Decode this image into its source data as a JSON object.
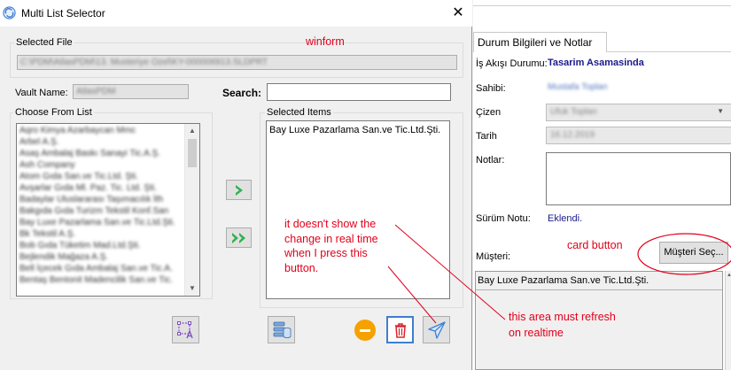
{
  "dialog": {
    "title": "Multi List Selector",
    "close_glyph": "✕",
    "selected_file": {
      "label": "Selected File",
      "value": "C:\\PDM\\AtlasPDM\\13. Musteriye Ozel\\KY-000006913.SLDPRT"
    },
    "vault": {
      "label": "Vault Name:",
      "value": "AtlasPDM"
    },
    "search": {
      "label": "Search:",
      "value": ""
    },
    "choose_list": {
      "label": "Choose From List",
      "items": [
        "Aqro Kimya Azarbaycan Mmc",
        "Arbel A.Ş.",
        "Asaş Ambalaj Baskı Sanayi Tic.A.Ş.",
        "Ash Company",
        "Atom Gıda San.ve Tic.Ltd. Şti.",
        "Avşarlar Gıda Ml. Paz. Tic. Ltd. Şti.",
        "Badaylar Uluslararası Taşımacılık İth",
        "Bakgıda Gıda Turizm Tekstil Konf.San",
        "Bay Luxe Pazarlama San.ve Tic.Ltd.Şti.",
        "Bk Tekstil A.Ş.",
        "Bob Gıda Tüketim Mad.Ltd.Şti.",
        "Bejlendik Mağaza A.Ş.",
        "Bell İçecek Gıda Ambalaj San.ve Tic.A.",
        "Bentaş Bentonit Madencilik San.ve Tic."
      ]
    },
    "selected_items": {
      "label": "Selected Items",
      "items": [
        "Bay Luxe Pazarlama San.ve Tic.Ltd.Şti."
      ]
    },
    "annotations": {
      "winform": "winform",
      "no_realtime": [
        "it doesn't show the",
        "change in real time",
        "when I press this",
        "button."
      ]
    }
  },
  "panel": {
    "tab": "Durum Bilgileri ve Notlar",
    "workflow": {
      "label": "İş Akışı Durumu:",
      "value": "Tasarim Asamasinda"
    },
    "owner": {
      "label": "Sahibi:",
      "value": "Mustafa Toplan"
    },
    "drawer": {
      "label": "Çizen",
      "value": "Ufuk Toplan"
    },
    "date": {
      "label": "Tarih",
      "value": "16.12.2019"
    },
    "notes": {
      "label": "Notlar:",
      "value": ""
    },
    "version_note": {
      "label": "Sürüm Notu:",
      "value": "Eklendi."
    },
    "customer": {
      "label": "Müşteri:",
      "button": "Müşteri Seç...",
      "value": "Bay Luxe Pazarlama San.ve Tic.Ltd.Şti."
    },
    "annotations": {
      "card_button": "card button",
      "refresh": [
        "this area must refresh",
        "on realtime"
      ]
    }
  },
  "colors": {
    "annotation_red": "#e0001b",
    "workflow_blue": "#1a1a8c",
    "accent_green": "#2db34a",
    "accent_orange": "#f5a100",
    "delete_red": "#d9262c",
    "send_blue": "#3c7fd1"
  }
}
